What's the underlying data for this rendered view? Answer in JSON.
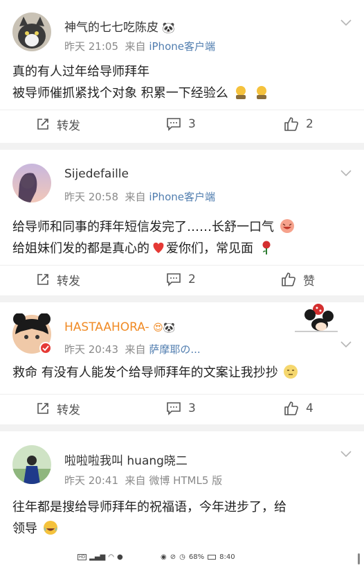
{
  "posts": [
    {
      "user": "神气的七七吃陈皮",
      "time": "昨天 21:05",
      "from_label": "来自",
      "source": "iPhone客户端",
      "lines": [
        "真的有人过年给导师拜年",
        "被导师催抓紧找个对象  积累一下经验么"
      ],
      "actions": {
        "repost": "转发",
        "comments": "3",
        "likes": "2"
      }
    },
    {
      "user": "Sijedefaille",
      "time": "昨天 20:58",
      "from_label": "来自",
      "source": "iPhone客户端",
      "lines": [
        "给导师和同事的拜年短信发完了……长舒一口气",
        "给姐妹们发的都是真心的",
        "爱你们，常见面"
      ],
      "actions": {
        "repost": "转发",
        "comments": "2",
        "likes": "赞"
      }
    },
    {
      "user": "HASTAAHORA-",
      "time": "昨天 20:43",
      "from_label": "来自",
      "source": "萨摩耶の...",
      "lines": [
        "救命 有没有人能发个给导师拜年的文案让我抄抄"
      ],
      "actions": {
        "repost": "转发",
        "comments": "3",
        "likes": "4"
      }
    },
    {
      "user": "啦啦啦我叫 huang晓二",
      "time": "昨天 20:41",
      "from_label": "来自",
      "source": "微博 HTML5 版",
      "lines": [
        "往年都是搜给导师拜年的祝福语，今年进步了，给",
        "领导"
      ]
    }
  ],
  "status_bar": {
    "battery": "68%",
    "time": "8:40"
  },
  "colors": {
    "orange_name": "#f08a24",
    "source_link": "#507daf",
    "separator": "#f2f2f2"
  },
  "icons": [
    "repost-icon",
    "comment-icon",
    "like-icon",
    "chevron-down-icon"
  ]
}
